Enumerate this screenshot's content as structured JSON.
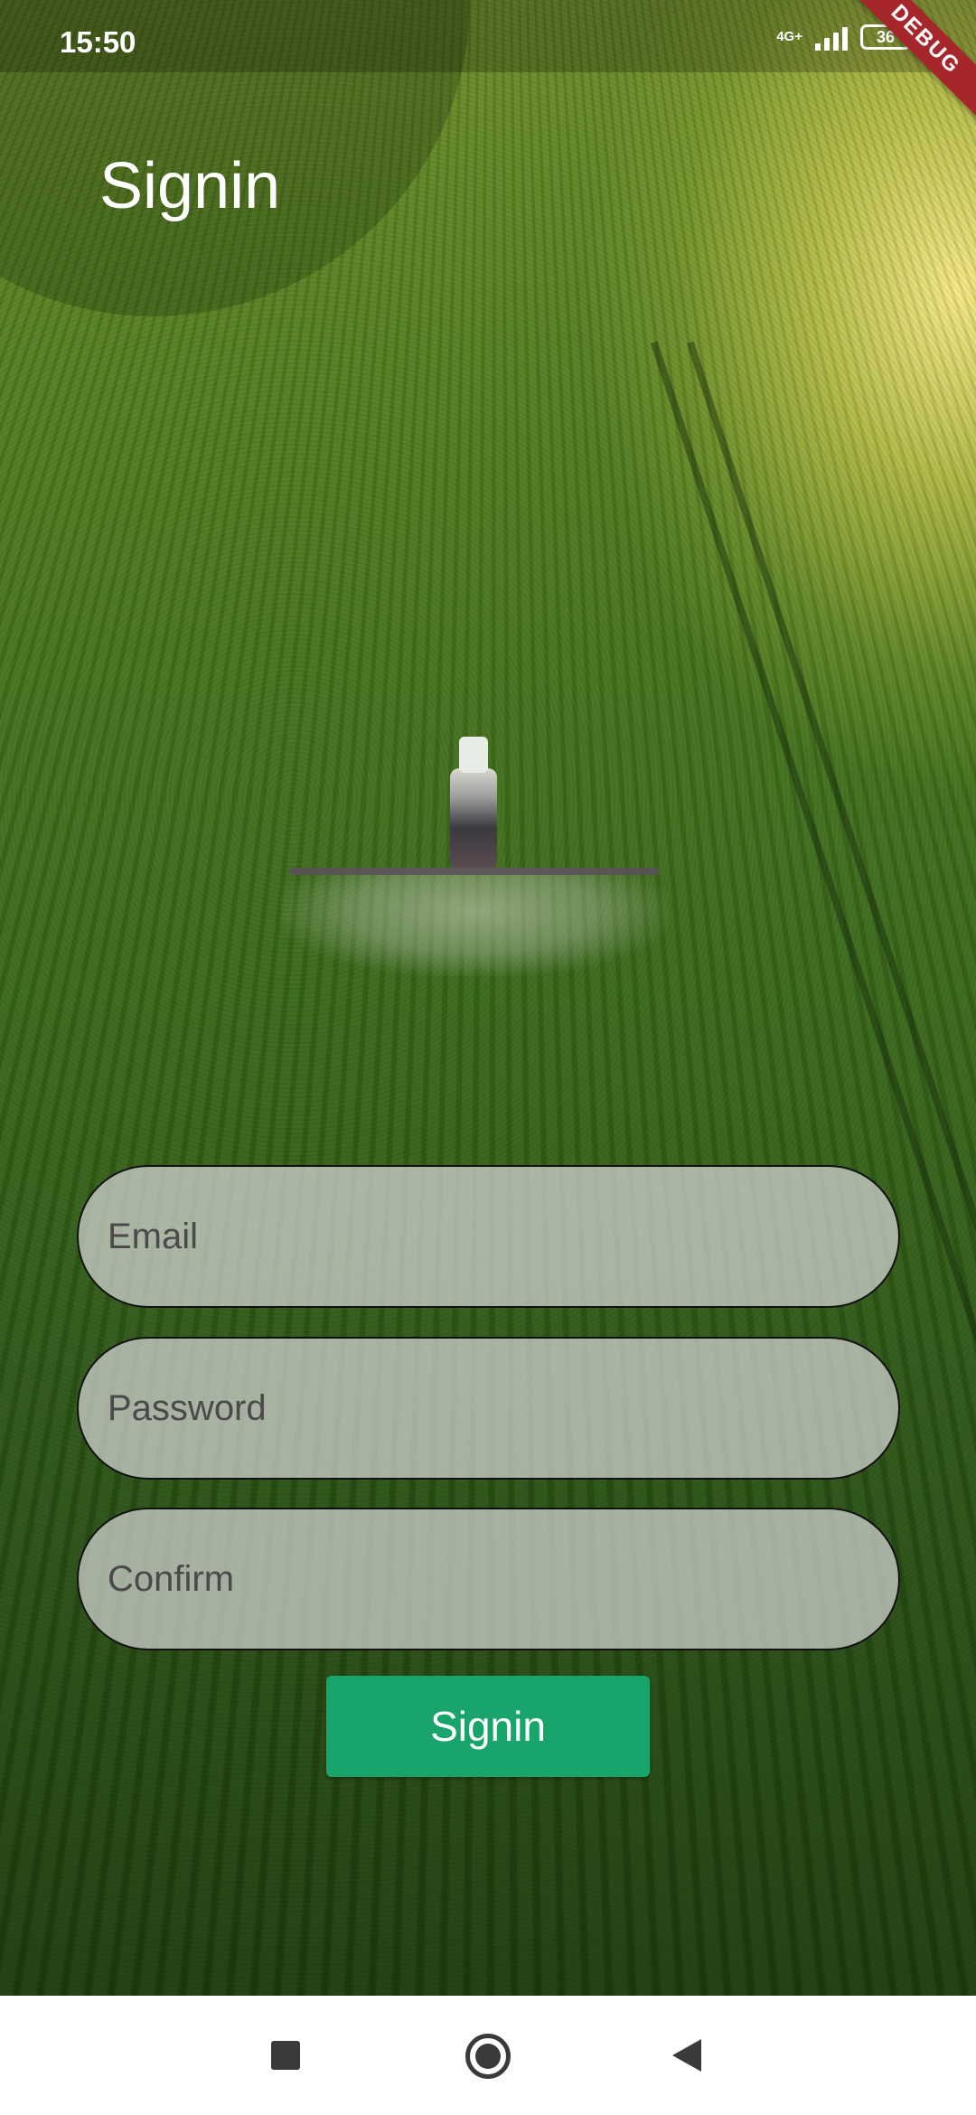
{
  "status_bar": {
    "time": "15:50",
    "network_type": "4G+",
    "battery_level": "36"
  },
  "debug_banner": {
    "label": "DEBUG"
  },
  "header": {
    "title": "Signin"
  },
  "form": {
    "email": {
      "placeholder": "Email",
      "value": ""
    },
    "password": {
      "placeholder": "Password",
      "value": ""
    },
    "confirm": {
      "placeholder": "Confirm",
      "value": ""
    },
    "submit_label": "Signin"
  },
  "colors": {
    "primary_button": "#18a46b",
    "field_background": "#d6d6d6",
    "field_border": "#111111"
  },
  "icons": {
    "nav_recents": "square-icon",
    "nav_home": "circle-icon",
    "nav_back": "triangle-back-icon",
    "signal": "cellular-signal-icon",
    "battery": "battery-icon"
  }
}
